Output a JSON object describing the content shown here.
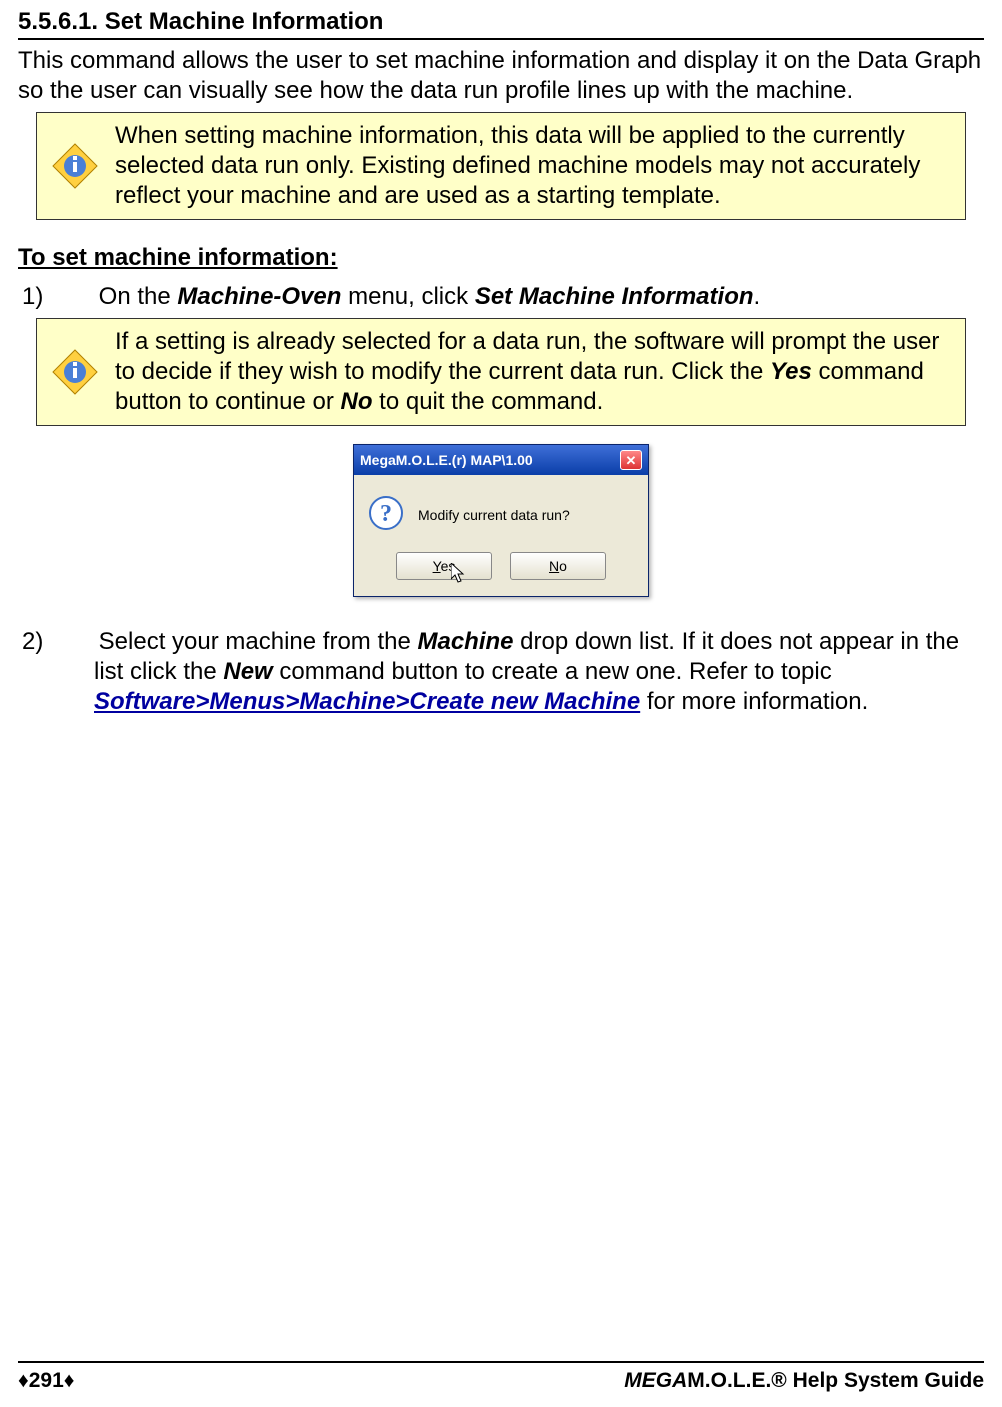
{
  "heading": "5.5.6.1. Set Machine Information",
  "intro": "This command allows the user to set machine information and display it on the Data Graph so the user can visually see how the data run profile lines up with the machine.",
  "note1": "When setting machine information, this data will be applied to the currently selected data run only. Existing defined machine models may not accurately reflect your machine and are used as a starting template.",
  "subheading": "To set machine information:",
  "step1_num": "1)",
  "step1_a": "On the ",
  "step1_menu": "Machine-Oven",
  "step1_b": " menu, click ",
  "step1_cmd": "Set Machine Information",
  "step1_c": ".",
  "note2_a": "If a setting is already selected for a data run, the software will prompt the user to decide if they wish to modify the current data run. Click the ",
  "note2_yes": "Yes",
  "note2_b": " command button to continue or ",
  "note2_no": "No",
  "note2_c": " to quit the command.",
  "dialog": {
    "title": "MegaM.O.L.E.(r) MAP\\1.00",
    "message": "Modify current data run?",
    "yes_label": "Yes",
    "no_label": "No"
  },
  "step2_num": "2)",
  "step2_a": "Select your machine from the ",
  "step2_machine": "Machine",
  "step2_b": " drop down list. If it does not appear in the list click the ",
  "step2_new": "New",
  "step2_c": " command button to create a new one. Refer to topic ",
  "step2_link": "Software>Menus>Machine>Create new Machine",
  "step2_d": " for more information.",
  "footer": {
    "page": "♦291♦",
    "guide_italic": "MEGA",
    "guide_rest": "M.O.L.E.® Help System Guide"
  }
}
